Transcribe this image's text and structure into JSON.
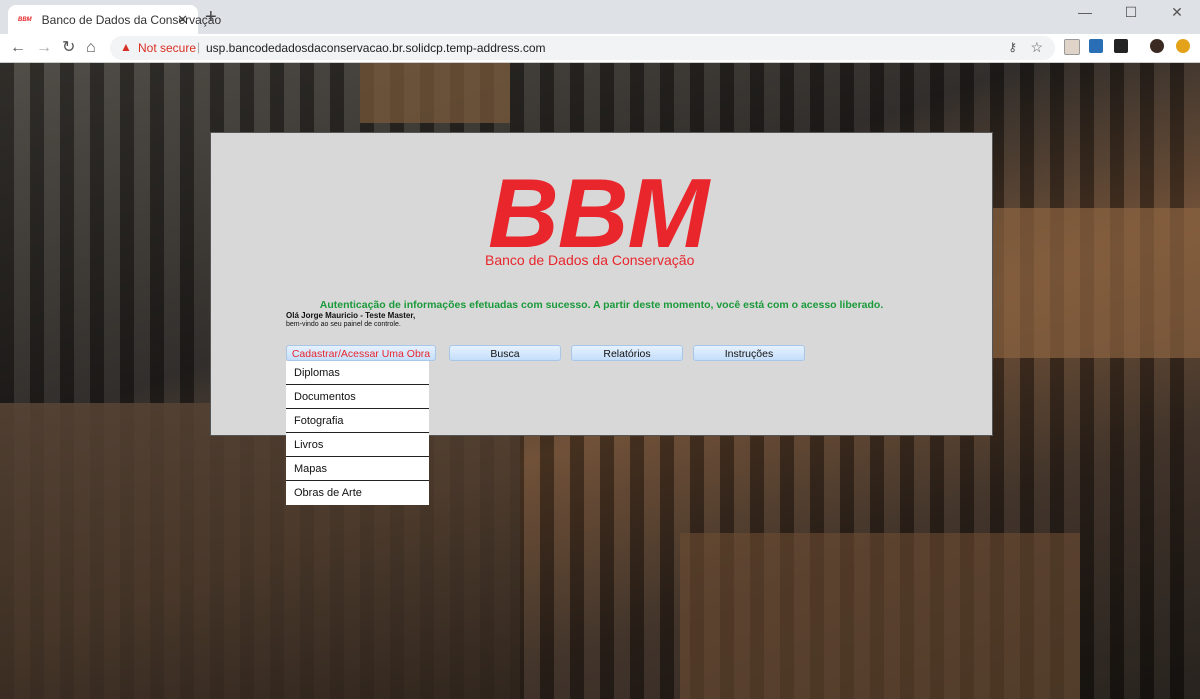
{
  "browser": {
    "tab_title": "Banco de Dados da Conservação",
    "favicon_text": "BBM",
    "tab_close": "✕",
    "new_tab": "+",
    "security_label": "Not secure",
    "url": "usp.bancodedadosdaconservacao.br.solidcp.temp-address.com",
    "icons": [
      "back-icon",
      "forward-icon",
      "reload-icon",
      "home-icon",
      "key-icon",
      "star-icon",
      "minimize-icon",
      "maximize-icon",
      "close-icon"
    ]
  },
  "logo": {
    "title": "BBM",
    "subtitle": "Banco de Dados da Conservação"
  },
  "auth_message": "Autenticação de informações efetuadas com sucesso. A partir deste momento, você está com o acesso liberado.",
  "greeting": "Olá Jorge Mauricio - Teste Master,",
  "welcome": "bem-vindo ao seu painel de controle.",
  "menu": [
    {
      "label": "Cadastrar/Acessar Uma Obra"
    },
    {
      "label": "Busca"
    },
    {
      "label": "Relatórios"
    },
    {
      "label": "Instruções"
    }
  ],
  "dropdown": [
    {
      "label": "Diplomas"
    },
    {
      "label": "Documentos"
    },
    {
      "label": "Fotografia"
    },
    {
      "label": "Livros"
    },
    {
      "label": "Mapas"
    },
    {
      "label": "Obras de Arte"
    }
  ],
  "colors": {
    "brand_red": "#e8262c",
    "success_green": "#1a9a3a",
    "panel_gray": "#d8d8d8"
  }
}
